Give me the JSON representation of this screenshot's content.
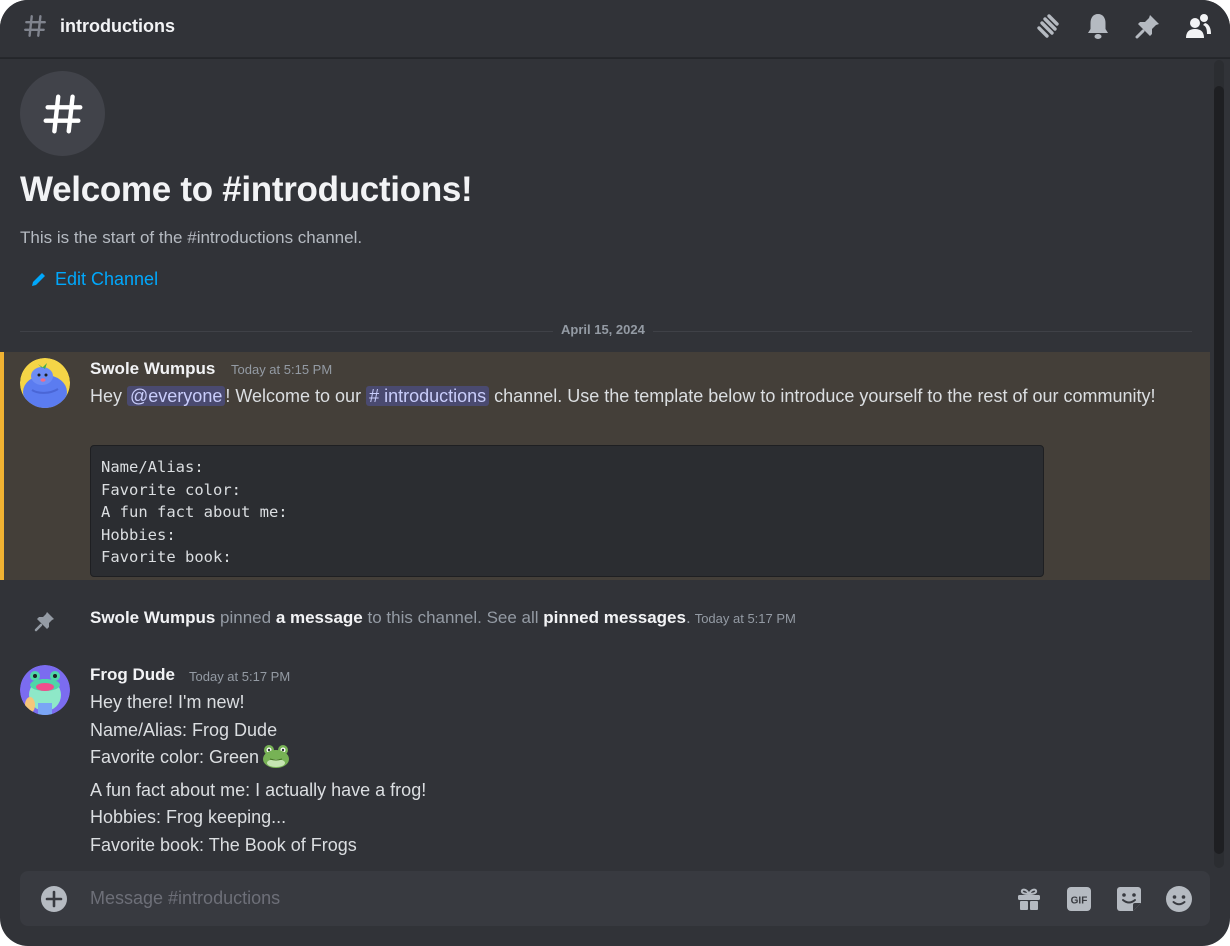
{
  "header": {
    "channel_name": "introductions",
    "icons": [
      "threads-icon",
      "bell-icon",
      "pin-icon",
      "member-list-icon"
    ]
  },
  "intro": {
    "title": "Welcome to #introductions!",
    "subtitle": "This is the start of the #introductions channel.",
    "edit_label": "Edit Channel"
  },
  "date_divider": "April 15, 2024",
  "messages": [
    {
      "author": "Swole Wumpus",
      "timestamp": "Today at 5:15 PM",
      "highlighted": true,
      "parts": {
        "hey": "Hey ",
        "mention": "@everyone",
        "after_mention": "! Welcome to our ",
        "channel_mention": "# introductions",
        "rest": " channel. Use the template below to introduce yourself to the rest of our community!"
      },
      "code_lines": [
        "Name/Alias:",
        "Favorite color:",
        "A fun fact about me:",
        "Hobbies:",
        "Favorite book:"
      ]
    },
    {
      "author": "Frog Dude",
      "timestamp": "Today at 5:17 PM",
      "lines": [
        "Hey there! I'm new!",
        "Name/Alias: Frog Dude",
        "Favorite color: Green",
        "A fun fact about me: I actually have a frog!",
        "Hobbies: Frog keeping...",
        "Favorite book: The Book of Frogs"
      ],
      "emoji": "frog-emoji"
    }
  ],
  "system_message": {
    "author": "Swole Wumpus",
    "pinned": " pinned ",
    "a_message": "a message",
    "to_channel": " to this channel. See all ",
    "pinned_messages": "pinned messages",
    "period": ".",
    "timestamp": "Today at 5:17 PM"
  },
  "composer": {
    "placeholder": "Message #introductions",
    "value": "",
    "icons": [
      "gift-icon",
      "gif-icon",
      "sticker-icon",
      "emoji-icon"
    ]
  },
  "colors": {
    "background": "#313338",
    "highlight_bg": "#443f39",
    "highlight_bar": "#f0b232",
    "link": "#00a8fc",
    "mention_bg": "#4a4e84"
  }
}
